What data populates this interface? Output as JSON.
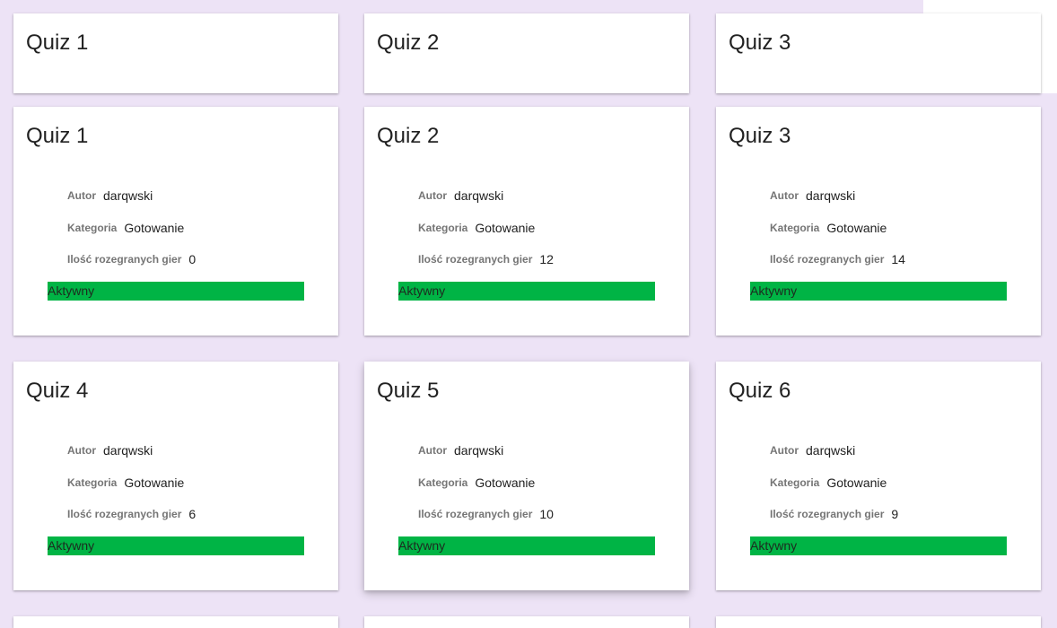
{
  "top_row": [
    {
      "title": "Quiz 1"
    },
    {
      "title": "Quiz 2"
    },
    {
      "title": "Quiz 3"
    }
  ],
  "labels": {
    "author": "Autor",
    "category": "Kategoria",
    "games_played": "Ilość rozegranych gier"
  },
  "quizzes": [
    {
      "title": "Quiz 1",
      "author": "darqwski",
      "category": "Gotowanie",
      "games_played": "0",
      "status": "Aktywny"
    },
    {
      "title": "Quiz 2",
      "author": "darqwski",
      "category": "Gotowanie",
      "games_played": "12",
      "status": "Aktywny"
    },
    {
      "title": "Quiz 3",
      "author": "darqwski",
      "category": "Gotowanie",
      "games_played": "14",
      "status": "Aktywny"
    },
    {
      "title": "Quiz 4",
      "author": "darqwski",
      "category": "Gotowanie",
      "games_played": "6",
      "status": "Aktywny"
    },
    {
      "title": "Quiz 5",
      "author": "darqwski",
      "category": "Gotowanie",
      "games_played": "10",
      "status": "Aktywny"
    },
    {
      "title": "Quiz 6",
      "author": "darqwski",
      "category": "Gotowanie",
      "games_played": "9",
      "status": "Aktywny"
    }
  ],
  "colors": {
    "background": "#ede3f6",
    "card": "#ffffff",
    "status_active": "#00b445"
  }
}
